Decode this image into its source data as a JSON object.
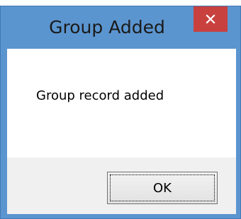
{
  "dialog": {
    "title": "Group Added",
    "close_icon": "close-icon",
    "message": "Group record added",
    "ok_label": "OK"
  },
  "colors": {
    "titlebar": "#5b95cf",
    "close_button": "#c8413f",
    "content_background": "#ffffff",
    "button_area_background": "#f0f0f0"
  }
}
